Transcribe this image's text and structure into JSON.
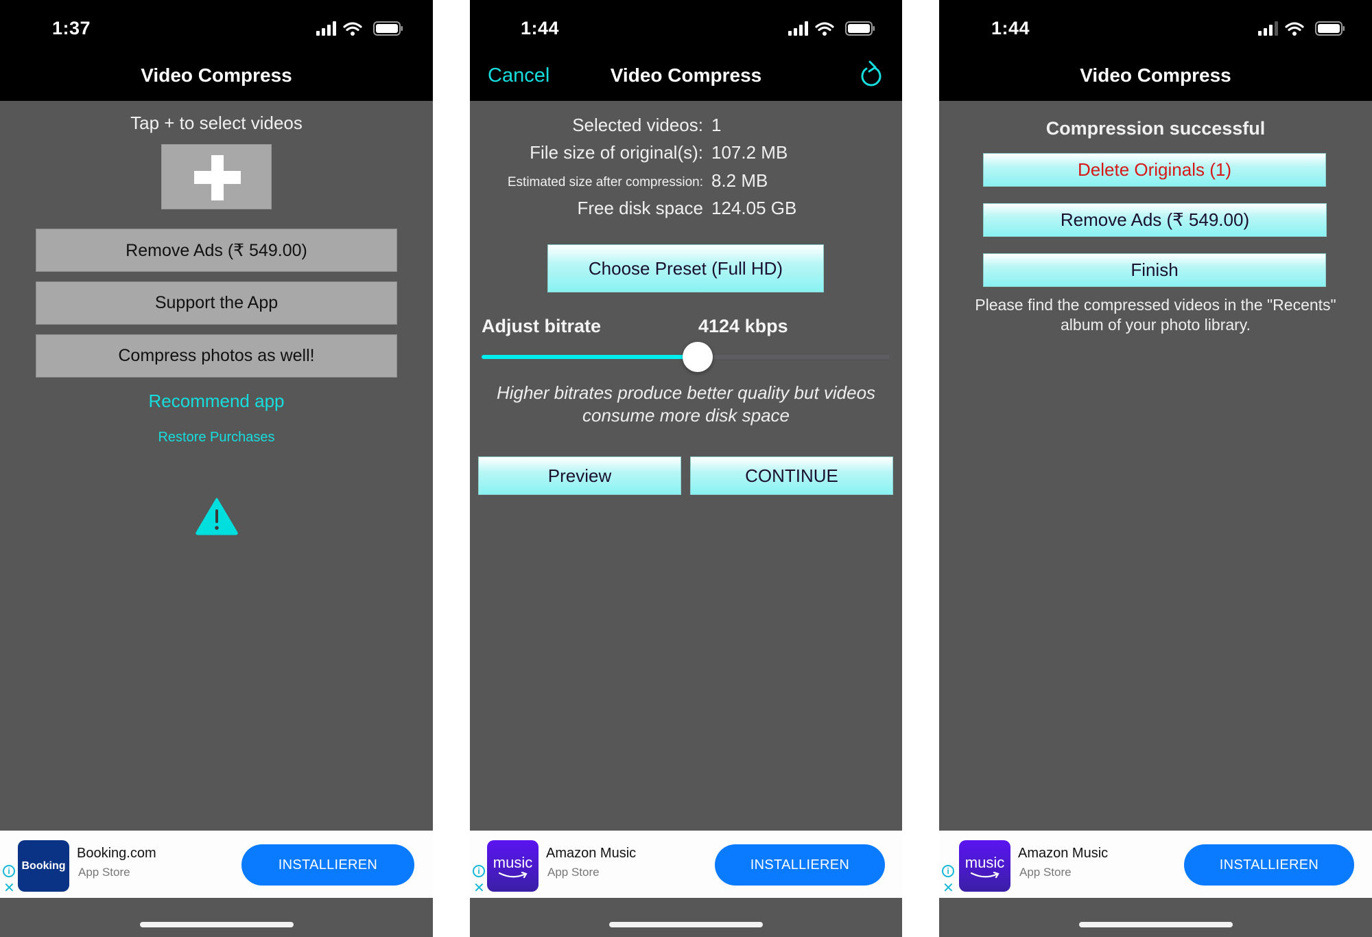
{
  "screens": [
    {
      "status": {
        "time": "1:37"
      },
      "nav": {
        "title": "Video Compress"
      },
      "prompt": "Tap + to select videos",
      "add_button_icon": "plus-icon",
      "buttons": {
        "remove_ads": "Remove Ads (₹ 549.00)",
        "support": "Support the App",
        "compress_photos": "Compress photos as well!"
      },
      "links": {
        "recommend": "Recommend app",
        "restore": "Restore Purchases"
      },
      "warning_icon": "warning-triangle-icon",
      "ad": {
        "icon_text": "Booking",
        "title": "Booking.com",
        "subtitle": "App Store",
        "cta": "INSTALLIEREN",
        "icon_color": "#0a3386"
      }
    },
    {
      "status": {
        "time": "1:44"
      },
      "nav": {
        "title": "Video Compress",
        "left": "Cancel",
        "right_icon": "refresh-icon"
      },
      "info": [
        {
          "label": "Selected videos:",
          "value": "1"
        },
        {
          "label": "File size of original(s):",
          "value": "107.2 MB"
        },
        {
          "label": "Estimated size after compression:",
          "value": "8.2 MB"
        },
        {
          "label": "Free disk space",
          "value": "124.05 GB"
        }
      ],
      "preset_button": "Choose Preset (Full HD)",
      "bitrate": {
        "label": "Adjust bitrate",
        "value_text": "4124 kbps",
        "slider_fraction": 0.53
      },
      "hint": "Higher bitrates produce better quality but videos consume more disk space",
      "buttons": {
        "preview": "Preview",
        "continue": "CONTINUE"
      },
      "ad": {
        "icon_text": "music",
        "title": "Amazon Music",
        "subtitle": "App Store",
        "cta": "INSTALLIEREN",
        "icon_color": "#4a17d8"
      }
    },
    {
      "status": {
        "time": "1:44"
      },
      "nav": {
        "title": "Video Compress"
      },
      "heading": "Compression successful",
      "buttons": {
        "delete": "Delete Originals (1)",
        "remove_ads": "Remove Ads (₹ 549.00)",
        "finish": "Finish"
      },
      "message": "Please find the compressed videos in the \"Recents\" album of your photo library.",
      "ad": {
        "icon_text": "music",
        "title": "Amazon Music",
        "subtitle": "App Store",
        "cta": "INSTALLIEREN",
        "icon_color": "#4a17d8"
      }
    }
  ],
  "colors": {
    "accent": "#16dede",
    "background": "#575757",
    "navbar": "#000000",
    "danger_text": "#d81818",
    "ad_button": "#0a7bff"
  }
}
